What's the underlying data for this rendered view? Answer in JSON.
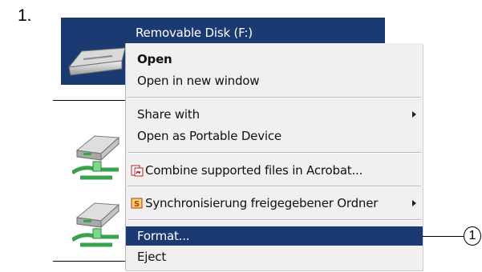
{
  "step": {
    "number": "1."
  },
  "drive": {
    "label": "Removable Disk (F:)",
    "icon": "usb-drive-icon"
  },
  "menu": {
    "items": [
      {
        "label": "Open"
      },
      {
        "label": "Open in new window"
      },
      {
        "label": "Share with"
      },
      {
        "label": "Open as Portable Device"
      },
      {
        "label": "Combine supported files in Acrobat...",
        "icon": "acrobat-icon"
      },
      {
        "label": "Synchronisierung freigegebener Ordner",
        "icon": "sync-s-icon"
      },
      {
        "label": "Format..."
      },
      {
        "label": "Eject"
      }
    ]
  },
  "callout": {
    "number": "1"
  },
  "colors": {
    "highlight": "#1c3a72",
    "menu_bg": "#f0f0f0"
  }
}
